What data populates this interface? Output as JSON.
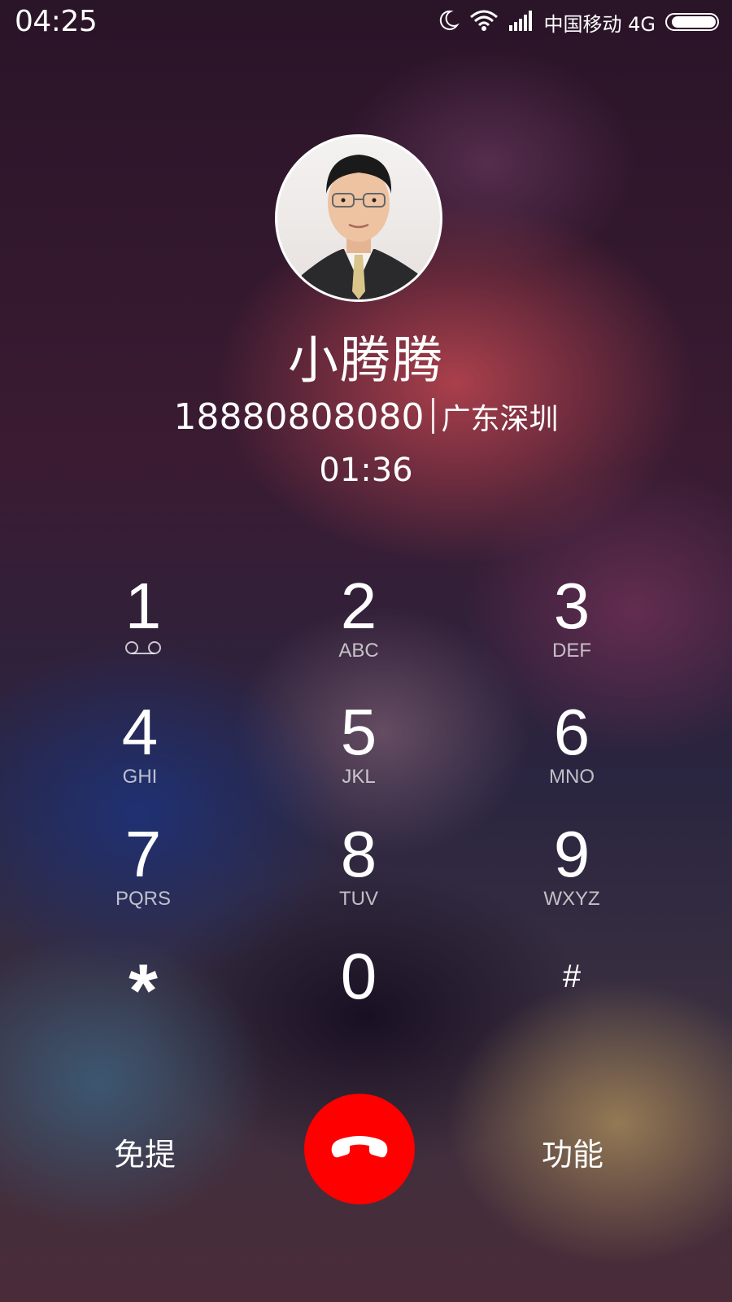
{
  "status_bar": {
    "time": "04:25",
    "carrier": "中国移动 4G",
    "icons": [
      "moon-icon",
      "wifi-icon",
      "signal-icon",
      "battery-icon"
    ]
  },
  "caller": {
    "name": "小腾腾",
    "number": "18880808080",
    "location": "广东深圳",
    "duration": "01:36"
  },
  "keypad": [
    {
      "digit": "1",
      "letters": ""
    },
    {
      "digit": "2",
      "letters": "ABC"
    },
    {
      "digit": "3",
      "letters": "DEF"
    },
    {
      "digit": "4",
      "letters": "GHI"
    },
    {
      "digit": "5",
      "letters": "JKL"
    },
    {
      "digit": "6",
      "letters": "MNO"
    },
    {
      "digit": "7",
      "letters": "PQRS"
    },
    {
      "digit": "8",
      "letters": "TUV"
    },
    {
      "digit": "9",
      "letters": "WXYZ"
    },
    {
      "digit": "*",
      "letters": ""
    },
    {
      "digit": "0",
      "letters": ""
    },
    {
      "digit": "#",
      "letters": ""
    }
  ],
  "controls": {
    "speaker_label": "免提",
    "more_label": "功能",
    "hangup_icon": "phone-hangup-icon",
    "hangup_color": "#ff0000"
  }
}
